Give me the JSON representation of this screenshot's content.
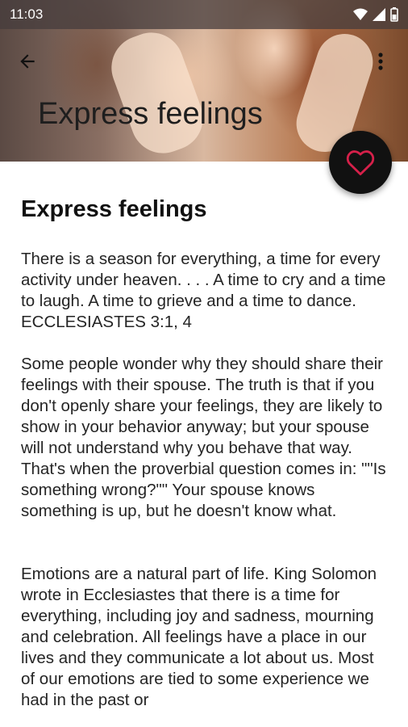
{
  "status_bar": {
    "time": "11:03"
  },
  "header": {
    "title": "Express feelings",
    "back_icon": "arrow-left-icon",
    "more_icon": "more-vert-icon",
    "fab_icon": "heart-outline-icon",
    "accent": "#d6204a"
  },
  "article": {
    "heading": "Express feelings",
    "paragraphs": [
      "There is a season for everything, a time for every activity under heaven. . . . A time to cry and a time to laugh. A time to grieve and a time to dance. ECCLESIASTES 3:1, 4",
      "Some people wonder why they should share their feelings with their spouse. The truth is that if you don't openly share your feelings, they are likely to show in your behavior anyway; but your spouse will not understand why you behave that way. That's when the proverbial question comes in: \"\"Is something wrong?\"\" Your spouse knows something is up, but he doesn't know what.",
      "Emotions are a natural part of life. King Solomon wrote in Ecclesiastes that there is a time for everything, including joy and sadness, mourning and celebration. All feelings have a place in our lives and they communicate a lot about us. Most of our emotions are tied to some experience we had in the past or"
    ]
  }
}
